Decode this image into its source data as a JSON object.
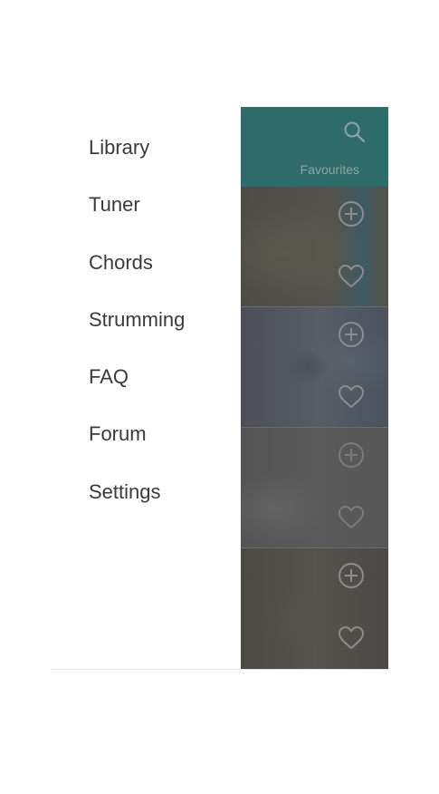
{
  "drawer": {
    "items": [
      {
        "label": "Library"
      },
      {
        "label": "Tuner"
      },
      {
        "label": "Chords"
      },
      {
        "label": "Strumming"
      },
      {
        "label": "FAQ"
      },
      {
        "label": "Forum"
      },
      {
        "label": "Settings"
      }
    ]
  },
  "content": {
    "tab_label": "Favourites",
    "header_icon": "search-icon",
    "card_icons": [
      "add-circle-icon",
      "heart-outline-icon"
    ]
  },
  "colors": {
    "header_teal": "#2f6b68",
    "drawer_text": "#3a3a3a",
    "icon_gray": "#8d8d8d"
  }
}
